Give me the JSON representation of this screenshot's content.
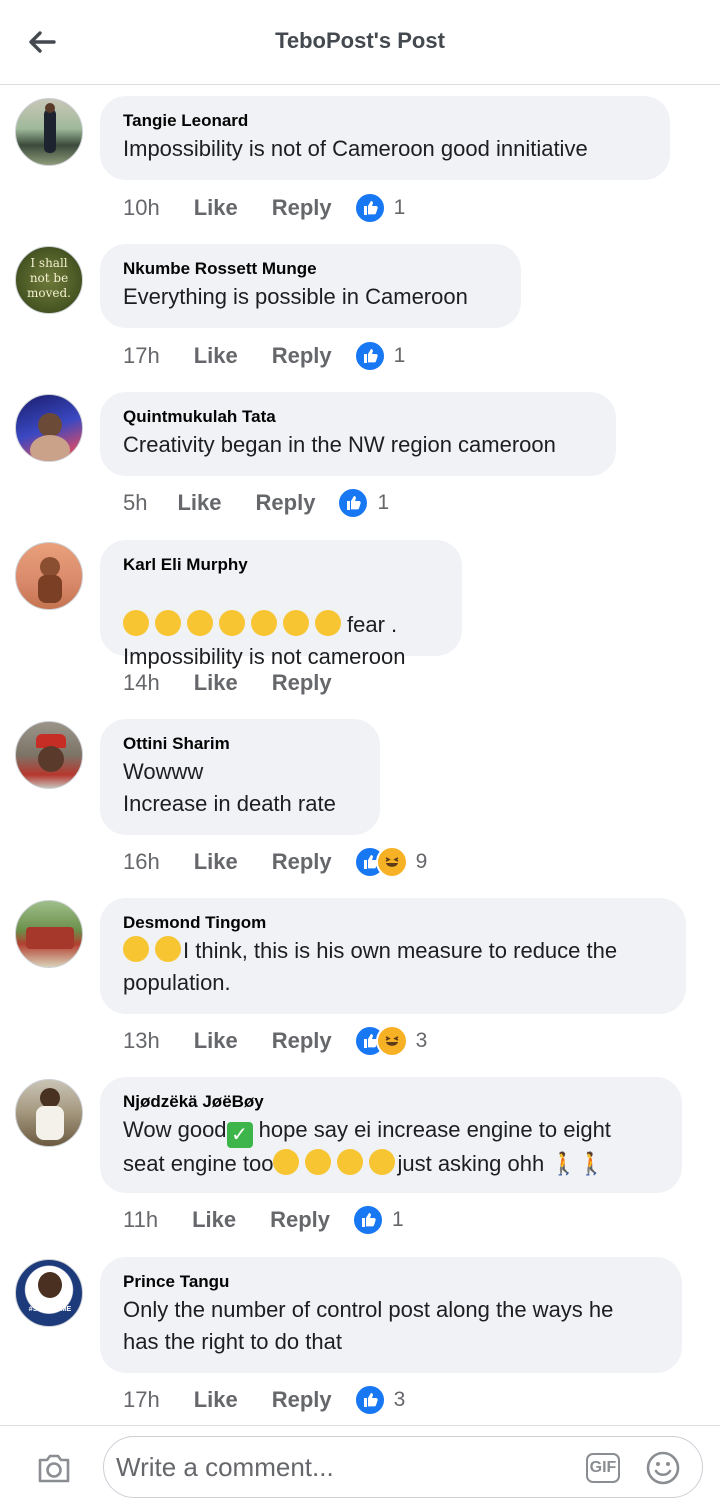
{
  "header": {
    "title": "TeboPost's Post"
  },
  "comments": [
    {
      "author": "Tangie Leonard",
      "text": "Impossibility is not of Cameroon good innitiative",
      "time": "10h",
      "like": "Like",
      "reply": "Reply",
      "reactions": [
        "like"
      ],
      "count": "1"
    },
    {
      "author": "Nkumbe Rossett Munge",
      "text": "Everything is possible in Cameroon",
      "time": "17h",
      "like": "Like",
      "reply": "Reply",
      "reactions": [
        "like"
      ],
      "count": "1",
      "avatar_text": "I shall not be moved."
    },
    {
      "author": "Quintmukulah Tata",
      "text": "Creativity began in the NW region cameroon",
      "time": "5h",
      "like": "Like",
      "reply": "Reply",
      "reactions": [
        "like"
      ],
      "count": "1"
    },
    {
      "author": "Karl Eli Murphy",
      "text_after_emoji": "fear .",
      "text": "Impossibility is not cameroon",
      "time": "14h",
      "like": "Like",
      "reply": "Reply",
      "reactions": [],
      "count": ""
    },
    {
      "author": "Ottini Sharim",
      "text": "Wowww\nIncrease in death rate",
      "time": "16h",
      "like": "Like",
      "reply": "Reply",
      "reactions": [
        "like",
        "haha"
      ],
      "count": "9"
    },
    {
      "author": "Desmond Tingom",
      "text_after_emoji": "I think, this is his own measure to reduce the",
      "text": "population.",
      "time": "13h",
      "like": "Like",
      "reply": "Reply",
      "reactions": [
        "like",
        "haha"
      ],
      "count": "3"
    },
    {
      "author": "Njødzëkä JøëBøy",
      "text_a": "Wow good",
      "text_b": "hope say ei increase engine to eight",
      "text_c": "seat engine too",
      "text_d": "just asking ohh",
      "time": "11h",
      "like": "Like",
      "reply": "Reply",
      "reactions": [
        "like"
      ],
      "count": "1"
    },
    {
      "author": "Prince Tangu",
      "text": "Only the number of control post along the ways he\nhas the right to do that",
      "time": "17h",
      "like": "Like",
      "reply": "Reply",
      "reactions": [
        "like"
      ],
      "count": "3",
      "avatar_text": "#STAYHOME"
    }
  ],
  "composer": {
    "placeholder": "Write a comment...",
    "gif": "GIF"
  },
  "colors": {
    "like_blue": "#1877f2",
    "bubble": "#f0f2f5",
    "meta_gray": "#65676b"
  },
  "icons": {
    "back": "back-arrow-icon",
    "camera": "camera-icon",
    "gif": "gif-icon",
    "emoji": "emoji-icon"
  }
}
